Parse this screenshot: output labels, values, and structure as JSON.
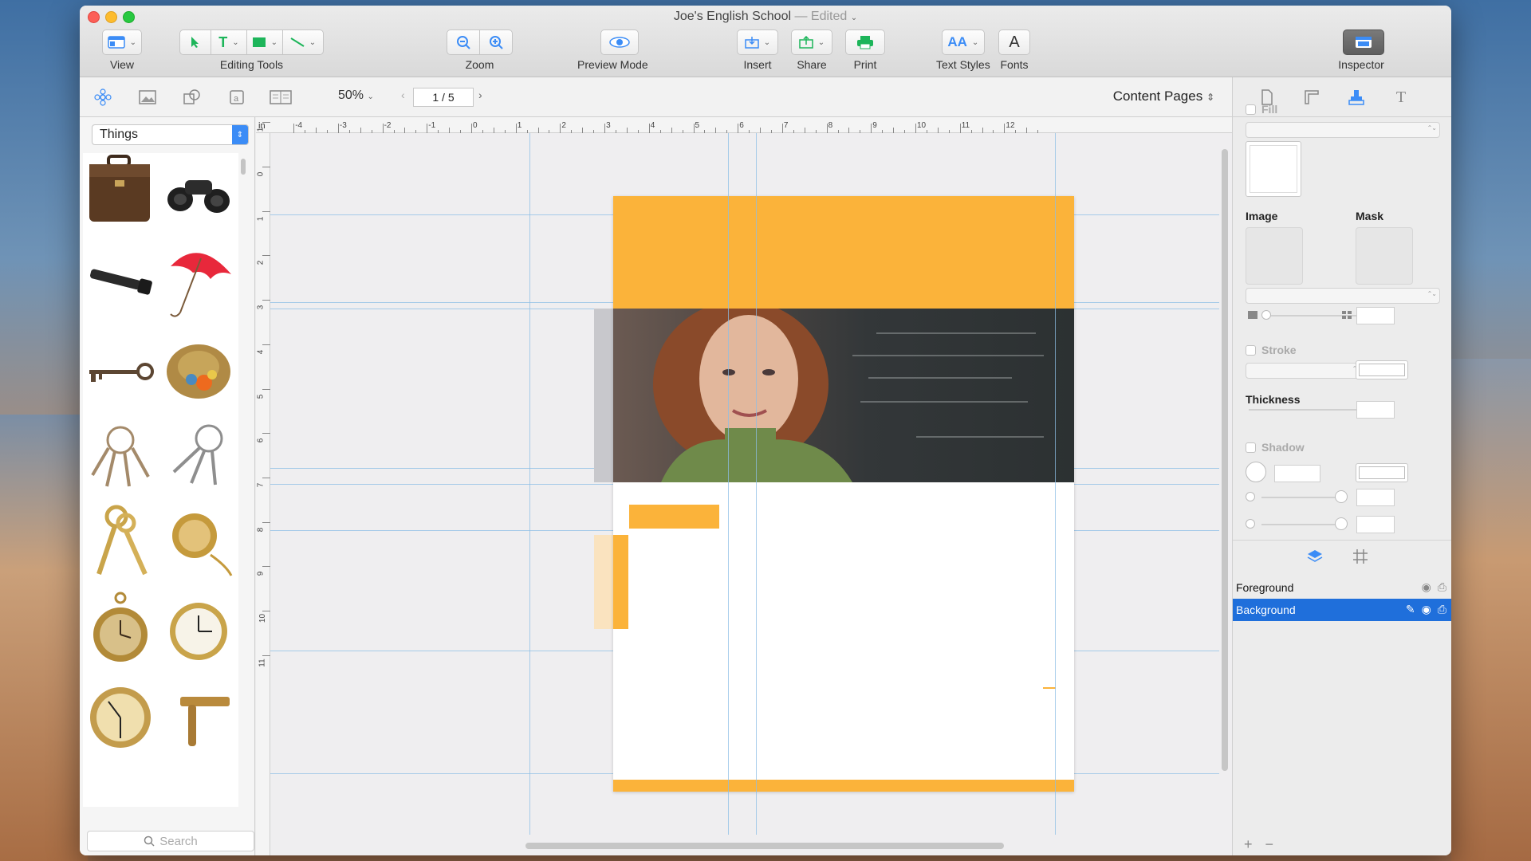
{
  "window": {
    "title": "Joe's English School",
    "edited_suffix": "— Edited"
  },
  "toolbar": {
    "view": "View",
    "editing_tools": "Editing Tools",
    "zoom": "Zoom",
    "preview_mode": "Preview Mode",
    "insert": "Insert",
    "share": "Share",
    "print": "Print",
    "text_styles": "Text Styles",
    "fonts": "Fonts",
    "inspector": "Inspector"
  },
  "subbar": {
    "zoom_value": "50%",
    "page_indicator": "1 / 5",
    "page_set": "Content Pages"
  },
  "library": {
    "category": "Things",
    "search_placeholder": "Search",
    "items": [
      "briefcase",
      "binoculars",
      "flashlight",
      "umbrella",
      "skeleton-key",
      "hat",
      "key-ring",
      "key-ring",
      "keys",
      "pocket-watch",
      "pocket-watch",
      "pocket-watch",
      "pocket-watch",
      "razor"
    ]
  },
  "ruler": {
    "unit": "in",
    "h_ticks": [
      "-4",
      "-3",
      "-2",
      "-1",
      "0",
      "1",
      "2",
      "3",
      "4",
      "5",
      "6",
      "7",
      "8",
      "9",
      "10",
      "11",
      "12"
    ],
    "v_ticks": [
      "1",
      "0",
      "1",
      "2",
      "3",
      "4",
      "5",
      "6",
      "7",
      "8",
      "9",
      "10",
      "11"
    ]
  },
  "inspector": {
    "fill": "Fill",
    "image": "Image",
    "mask": "Mask",
    "stroke": "Stroke",
    "thickness": "Thickness",
    "shadow": "Shadow"
  },
  "layers": [
    {
      "name": "Foreground",
      "selected": false
    },
    {
      "name": "Background",
      "selected": true
    }
  ],
  "colors": {
    "accent": "#fbb33a",
    "selection": "#1f6fdb"
  }
}
